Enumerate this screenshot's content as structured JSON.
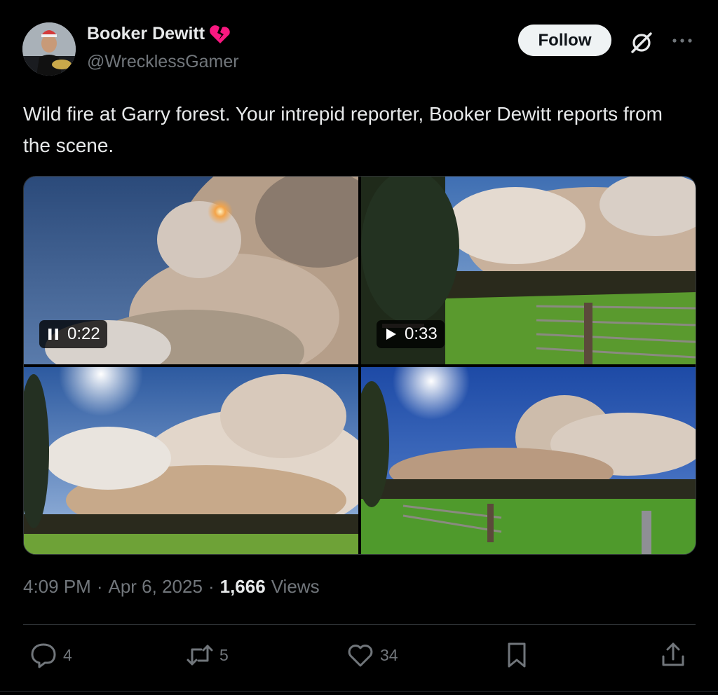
{
  "author": {
    "display_name": "Booker Dewitt",
    "name_emoji": "broken-heart-icon",
    "handle": "@WrecklessGamer",
    "avatar": "avatar"
  },
  "header": {
    "follow_label": "Follow",
    "grok_icon": "grok-icon",
    "more_icon": "more-icon"
  },
  "tweet": {
    "text": "Wild fire at Garry forest.  Your intrepid reporter, Booker Dewitt reports from the scene."
  },
  "media": [
    {
      "kind": "video",
      "duration": "0:22",
      "state_icon": "pause-icon",
      "playing": true
    },
    {
      "kind": "video",
      "duration": "0:33",
      "state_icon": "play-icon",
      "playing": false
    },
    {
      "kind": "photo"
    },
    {
      "kind": "photo"
    }
  ],
  "meta": {
    "time": "4:09 PM",
    "separator": "·",
    "date": "Apr 6, 2025",
    "views_count": "1,666",
    "views_label": "Views"
  },
  "actions": {
    "replies": "4",
    "reposts": "5",
    "likes": "34",
    "bookmark_icon": "bookmark-icon",
    "share_icon": "share-icon"
  },
  "colors": {
    "background": "#000000",
    "text": "#e7e9ea",
    "secondary": "#71767b",
    "follow_bg": "#eff3f4",
    "divider": "#2f3336",
    "heart": "#f91880"
  }
}
